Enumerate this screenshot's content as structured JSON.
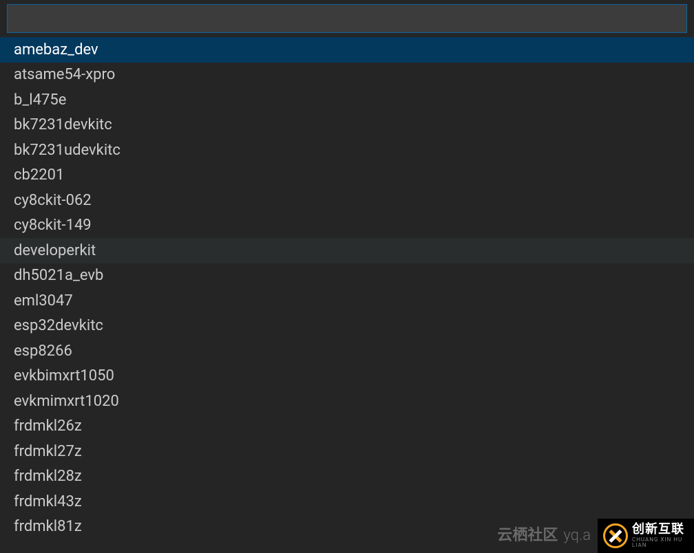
{
  "search": {
    "value": "",
    "placeholder": ""
  },
  "items": [
    {
      "label": "amebaz_dev",
      "selected": true,
      "hovered": false
    },
    {
      "label": "atsame54-xpro",
      "selected": false,
      "hovered": false
    },
    {
      "label": "b_l475e",
      "selected": false,
      "hovered": false
    },
    {
      "label": "bk7231devkitc",
      "selected": false,
      "hovered": false
    },
    {
      "label": "bk7231udevkitc",
      "selected": false,
      "hovered": false
    },
    {
      "label": "cb2201",
      "selected": false,
      "hovered": false
    },
    {
      "label": "cy8ckit-062",
      "selected": false,
      "hovered": false
    },
    {
      "label": "cy8ckit-149",
      "selected": false,
      "hovered": false
    },
    {
      "label": "developerkit",
      "selected": false,
      "hovered": true
    },
    {
      "label": "dh5021a_evb",
      "selected": false,
      "hovered": false
    },
    {
      "label": "eml3047",
      "selected": false,
      "hovered": false
    },
    {
      "label": "esp32devkitc",
      "selected": false,
      "hovered": false
    },
    {
      "label": "esp8266",
      "selected": false,
      "hovered": false
    },
    {
      "label": "evkbimxrt1050",
      "selected": false,
      "hovered": false
    },
    {
      "label": "evkmimxrt1020",
      "selected": false,
      "hovered": false
    },
    {
      "label": "frdmkl26z",
      "selected": false,
      "hovered": false
    },
    {
      "label": "frdmkl27z",
      "selected": false,
      "hovered": false
    },
    {
      "label": "frdmkl28z",
      "selected": false,
      "hovered": false
    },
    {
      "label": "frdmkl43z",
      "selected": false,
      "hovered": false
    },
    {
      "label": "frdmkl81z",
      "selected": false,
      "hovered": false
    }
  ],
  "watermark": {
    "bold_text": "云栖社区",
    "light_text": "yq.a"
  },
  "logo": {
    "main_text": "创新互联",
    "sub_text": "CHUANG XIN HU LIAN"
  }
}
